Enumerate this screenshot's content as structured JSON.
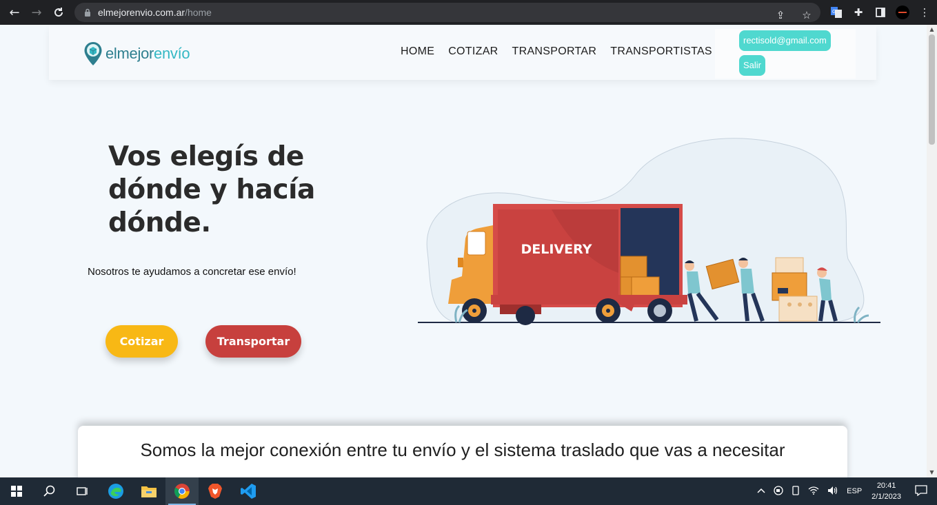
{
  "browser": {
    "url_domain": "elmejorenvio.com.ar",
    "url_path": "/home"
  },
  "header": {
    "logo": {
      "part1": "elmejor",
      "part2": "envío"
    },
    "menu": [
      "HOME",
      "COTIZAR",
      "TRANSPORTAR",
      "TRANSPORTISTAS"
    ],
    "user_email": "rectisold@gmail.com",
    "logout_label": "Salir"
  },
  "hero": {
    "title": "Vos elegís de dónde y hacía dónde.",
    "subtitle": "Nosotros te ayudamos a concretar ese envío!",
    "cotizar_label": "Cotizar",
    "transportar_label": "Transportar",
    "illustration_text": "DELIVERY"
  },
  "section": {
    "heading": "Somos la mejor conexión entre tu envío y el sistema traslado que vas a necesitar"
  },
  "taskbar": {
    "language": "ESP",
    "time": "20:41",
    "date": "2/1/2023"
  },
  "colors": {
    "accent": "#4fd8cf",
    "cotizar": "#f8b815",
    "transportar": "#c7403d"
  }
}
